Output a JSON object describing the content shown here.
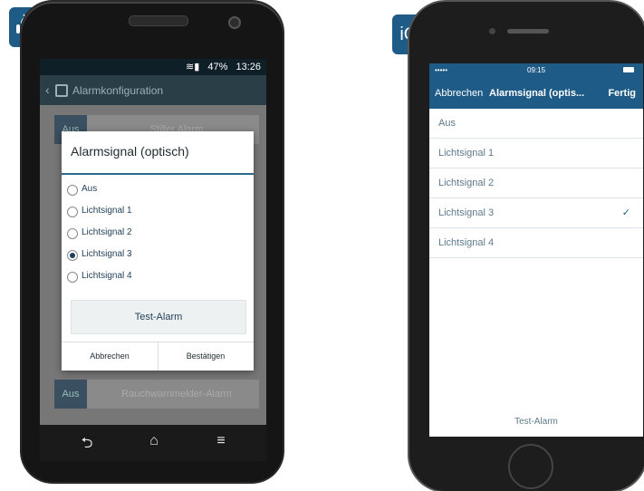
{
  "platform_badges": {
    "android_icon": "android-robot-icon",
    "ios": "iOS"
  },
  "android": {
    "status_bar": "13:26",
    "battery": "47%",
    "app_title": "Alarmkonfiguration",
    "background_rows": [
      {
        "badge": "Aus",
        "label": "Stiller Alarm"
      },
      {
        "badge": "Aus",
        "label": "Rauchwarnmelder-Alarm"
      }
    ],
    "dialog": {
      "title": "Alarmsignal (optisch)",
      "options": [
        "Aus",
        "Lichtsignal 1",
        "Lichtsignal 2",
        "Lichtsignal 3",
        "Lichtsignal 4"
      ],
      "selected": "Lichtsignal 3",
      "test_button": "Test-Alarm",
      "cancel": "Abbrechen",
      "confirm": "Bestätigen"
    },
    "nav_icons": [
      "back-icon",
      "home-icon",
      "menu-icon"
    ]
  },
  "ios": {
    "time": "09:15",
    "nav_left": "Abbrechen",
    "nav_title": "Alarmsignal (optis...",
    "nav_right": "Fertig",
    "options": [
      "Aus",
      "Lichtsignal 1",
      "Lichtsignal 2",
      "Lichtsignal 3",
      "Lichtsignal 4"
    ],
    "selected": "Lichtsignal 3",
    "checkmark": "✓",
    "test_button": "Test-Alarm"
  },
  "colors": {
    "accent": "#1e5b86",
    "appbar": "#2a3e48"
  }
}
